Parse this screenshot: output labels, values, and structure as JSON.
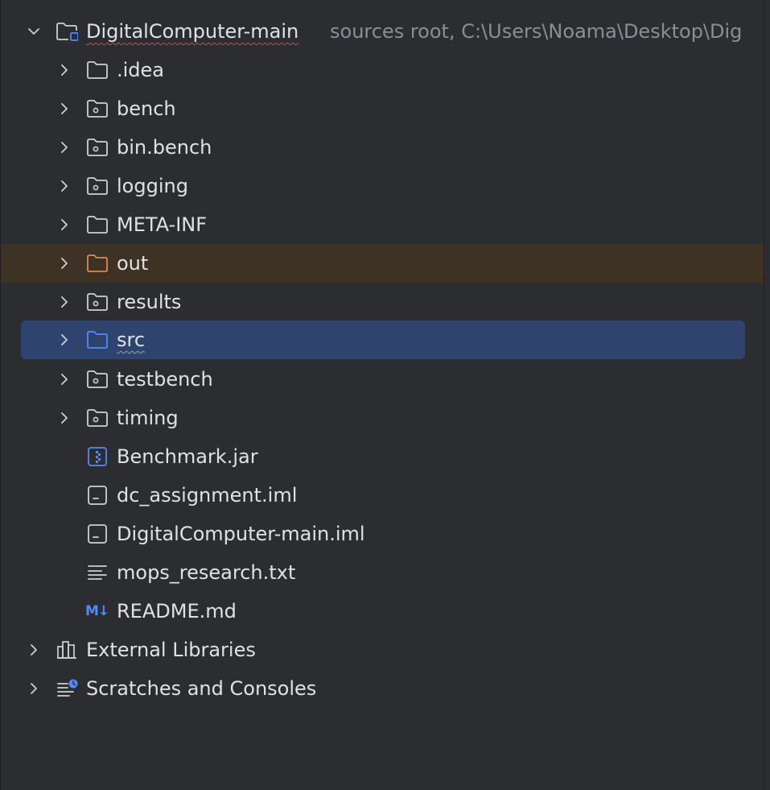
{
  "project_view": {
    "root": {
      "name": "DigitalComputer-main",
      "hint": "sources root,  C:\\Users\\Noama\\Desktop\\Dig",
      "icon": "module-folder-icon",
      "expanded": true
    },
    "items": [
      {
        "label": ".idea",
        "icon": "folder-icon",
        "expandable": true
      },
      {
        "label": "bench",
        "icon": "resource-folder-icon",
        "expandable": true
      },
      {
        "label": "bin.bench",
        "icon": "resource-folder-icon",
        "expandable": true
      },
      {
        "label": "logging",
        "icon": "resource-folder-icon",
        "expandable": true
      },
      {
        "label": "META-INF",
        "icon": "folder-icon",
        "expandable": true
      },
      {
        "label": "out",
        "icon": "excluded-folder-icon",
        "expandable": true,
        "highlighted": true
      },
      {
        "label": "results",
        "icon": "resource-folder-icon",
        "expandable": true
      },
      {
        "label": "src",
        "icon": "source-folder-icon",
        "expandable": true,
        "selected": true
      },
      {
        "label": "testbench",
        "icon": "resource-folder-icon",
        "expandable": true
      },
      {
        "label": "timing",
        "icon": "resource-folder-icon",
        "expandable": true
      },
      {
        "label": "Benchmark.jar",
        "icon": "jar-file-icon",
        "expandable": false
      },
      {
        "label": "dc_assignment.iml",
        "icon": "iml-file-icon",
        "expandable": false
      },
      {
        "label": "DigitalComputer-main.iml",
        "icon": "iml-file-icon",
        "expandable": false
      },
      {
        "label": "mops_research.txt",
        "icon": "text-file-icon",
        "expandable": false
      },
      {
        "label": "README.md",
        "icon": "markdown-file-icon",
        "icon_text": "M↓",
        "expandable": false
      }
    ],
    "external_libraries": {
      "label": "External Libraries",
      "icon": "library-icon"
    },
    "scratches": {
      "label": "Scratches and Consoles",
      "icon": "scratches-icon"
    }
  },
  "colors": {
    "background": "#2b2d30",
    "text": "#dfe1e5",
    "hint_text": "#8b8e94",
    "selection": "#2e436e",
    "excluded_highlight": "#3d3224",
    "excluded_folder": "#e08855",
    "source_folder": "#548af7",
    "icon_grey": "#ced0d6"
  }
}
